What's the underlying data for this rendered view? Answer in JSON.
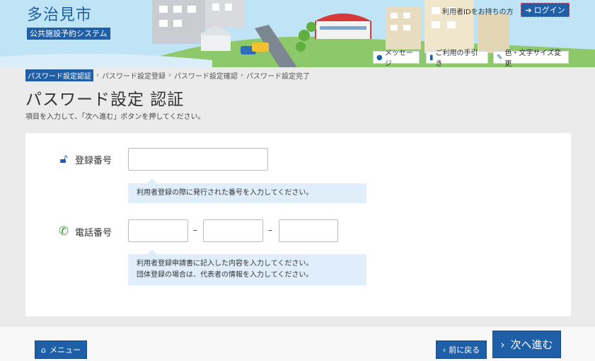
{
  "header": {
    "site_title": "多治見市",
    "system_name": "公共施設予約システム",
    "login_hint": "利用者IDをお持ちの方",
    "login_label": "ログイン",
    "util": {
      "message": "メッセージ",
      "guide": "ご利用の手引き",
      "display": "色・文字サイズ変更"
    }
  },
  "breadcrumb": {
    "steps": [
      "パスワード設定認証",
      "パスワード設定登録",
      "パスワード設定確認",
      "パスワード設定完了"
    ],
    "separator": "›"
  },
  "page": {
    "title": "パスワード設定 認証",
    "instruction": "項目を入力して、「次へ進む」ボタンを押してください。"
  },
  "form": {
    "registration": {
      "label": "登録番号",
      "value": "",
      "hint": "利用者登録の際に発行された番号を入力してください。"
    },
    "phone": {
      "label": "電話番号",
      "part1": "",
      "part2": "",
      "part3": "",
      "dash": "–",
      "hint_line1": "利用者登録申請書に記入した内容を入力してください。",
      "hint_line2": "団体登録の場合は、代表者の情報を入力してください。"
    }
  },
  "footer": {
    "menu_label": "メニュー",
    "back_label": "前に戻る",
    "next_label": "次へ進む"
  },
  "colors": {
    "primary": "#1f5fa8",
    "hint_bg": "#dfeefa",
    "phone_icon": "#3a9a3a"
  }
}
